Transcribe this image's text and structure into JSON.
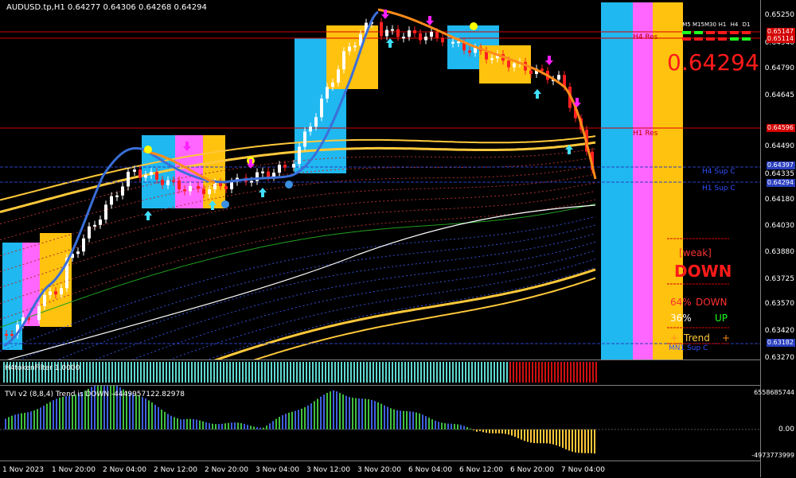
{
  "symbol_header": {
    "text": "AUDUSD.tp,H1  0.64277 0.64306 0.64268 0.64294"
  },
  "price_axis": {
    "ticks": [
      "0.65250",
      "0.64940",
      "0.64790",
      "0.64645",
      "0.64490",
      "0.64335",
      "0.64180",
      "0.64030",
      "0.63880",
      "0.63725",
      "0.63570",
      "0.63420",
      "0.63270"
    ]
  },
  "price_tags": [
    {
      "text": "0.65147",
      "color": "#d40000"
    },
    {
      "text": "0.65114",
      "color": "#d40000"
    },
    {
      "text": "0.64596",
      "color": "#d40000"
    },
    {
      "text": "0.64397",
      "color": "#2a3fbf"
    },
    {
      "text": "0.64294",
      "color": "#2a3fbf"
    },
    {
      "text": "0.63182",
      "color": "#2a3fbf"
    }
  ],
  "levels": {
    "h4_res": "H4 Res",
    "h1_res": "H1 Res",
    "h4_sup": "H4 Sup C",
    "h1_sup": "H1 Sup C",
    "mn_sup": "MN1 Sup C"
  },
  "timeframes": [
    "M5",
    "M15",
    "M30",
    "H1",
    "H4",
    "D1"
  ],
  "current_price": "0.64294",
  "dashboard": {
    "weak_label": "[weak]",
    "direction": "DOWN",
    "down_pct": "64%",
    "down_label": "DOWN",
    "up_pct": "36%",
    "up_label": "UP",
    "trend_label": "Trend",
    "plus": "+"
  },
  "filter_panel": {
    "label": "H4tokenFilter 1.0000"
  },
  "tvi_panel": {
    "label": "TVI v2 (8,8,4) Trend is DOWN -4449957122.82978",
    "axis": [
      "6558685744",
      "0.00",
      "-4973773999"
    ]
  },
  "time_axis": [
    "1 Nov 2023",
    "1 Nov 20:00",
    "2 Nov 04:00",
    "2 Nov 12:00",
    "2 Nov 20:00",
    "3 Nov 04:00",
    "3 Nov 12:00",
    "3 Nov 20:00",
    "6 Nov 04:00",
    "6 Nov 12:00",
    "6 Nov 20:00",
    "7 Nov 04:00"
  ],
  "colors": {
    "bull_candle": "#ffffff",
    "bear_candle": "#ff2020",
    "ema_blue": "#3a6fd8",
    "ema_orange": "#ff8c1a",
    "band_yellow": "#ffc83a",
    "box_cyan": "#1fb8f0",
    "box_pink": "#ff66ff",
    "box_yellow": "#ffc20e",
    "filter_cyan": "#5fd8d0",
    "filter_red": "#d01010"
  }
}
